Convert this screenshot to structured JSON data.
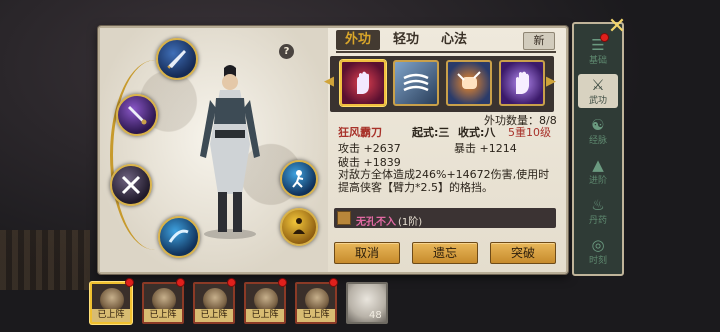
{
  "tabs": {
    "outer": "外功",
    "qinggong": "轻功",
    "heart": "心法",
    "new": "新"
  },
  "help_label": "?",
  "skill_strip": {
    "prev_arrow": "◀",
    "next_arrow": "▶",
    "count_label": "外功数量：8/8"
  },
  "selected_skill": {
    "name": "狂风霸刀",
    "stance_label": "起式:三",
    "finish_label": "收式:八",
    "level": "5重10级",
    "attack": "攻击 +2637",
    "crit": "暴击 +1214",
    "break": "破击 +1839",
    "description": "对敌方全体造成246%+14672伤害,使用时提高侠客【臂力*2.5】的格挡。",
    "book_name": "无孔不入",
    "book_tier": "(1阶)"
  },
  "buttons": {
    "cancel": "取消",
    "forget": "遗忘",
    "breakthrough": "突破"
  },
  "side_menu": [
    {
      "glyph": "☰",
      "label": "基础",
      "active": false
    },
    {
      "glyph": "⚔",
      "label": "武功",
      "active": true
    },
    {
      "glyph": "☯",
      "label": "经脉",
      "active": false
    },
    {
      "glyph": "▲",
      "label": "进阶",
      "active": false
    },
    {
      "glyph": "♨",
      "label": "丹药",
      "active": false
    },
    {
      "glyph": "◎",
      "label": "时刻",
      "active": false
    }
  ],
  "roster": [
    {
      "tag": "已上阵",
      "selected": true
    },
    {
      "tag": "已上阵",
      "selected": false
    },
    {
      "tag": "已上阵",
      "selected": false
    },
    {
      "tag": "已上阵",
      "selected": false
    },
    {
      "tag": "已上阵",
      "selected": false
    }
  ],
  "elder_level": "48",
  "colors": {
    "gold_accent": "#d9a62a",
    "skill_name_red": "#a8322a",
    "button_orange": "#d69a3a"
  }
}
